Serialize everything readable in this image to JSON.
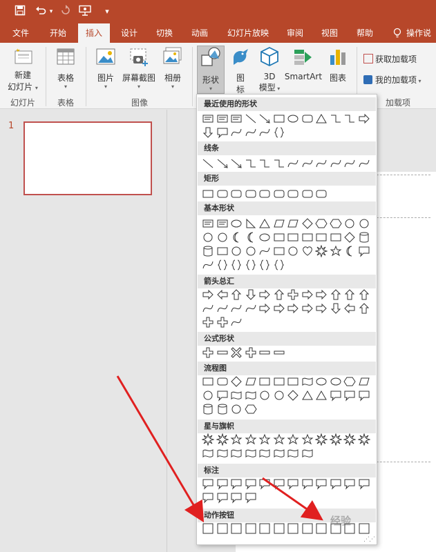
{
  "quick_access": {
    "items": [
      "save-icon",
      "undo-icon",
      "undo-dropdown-icon",
      "redo-icon",
      "presenter-icon",
      "customize-icon"
    ]
  },
  "tabs": [
    "文件",
    "开始",
    "插入",
    "设计",
    "切换",
    "动画",
    "幻灯片放映",
    "审阅",
    "视图",
    "帮助",
    "操作说"
  ],
  "active_tab": "插入",
  "ribbon": {
    "new_slide": "新建\n幻灯片",
    "new_slide_l1": "新建",
    "new_slide_l2": "幻灯片",
    "table": "表格",
    "picture": "图片",
    "screenshot": "屏幕截图",
    "album": "相册",
    "shapes": "形状",
    "icons": "图\n标",
    "icons_l1": "图",
    "icons_l2": "标",
    "model_3d_l1": "3D",
    "model_3d_l2": "模型",
    "smartart": "SmartArt",
    "chart": "图表",
    "get_addins": "获取加载项",
    "my_addins": "我的加载项",
    "group_slides": "幻灯片",
    "group_tables": "表格",
    "group_images": "图像",
    "group_addins": "加载项"
  },
  "slide_pane": {
    "slide_number": "1"
  },
  "shapes_menu": {
    "categories": [
      "最近使用的形状",
      "线条",
      "矩形",
      "基本形状",
      "箭头总汇",
      "公式形状",
      "流程图",
      "星与旗帜",
      "标注",
      "动作按钮"
    ]
  },
  "watermark": "经验",
  "colors": {
    "brand": "#b7472a",
    "annotation_arrow": "#e02020"
  }
}
